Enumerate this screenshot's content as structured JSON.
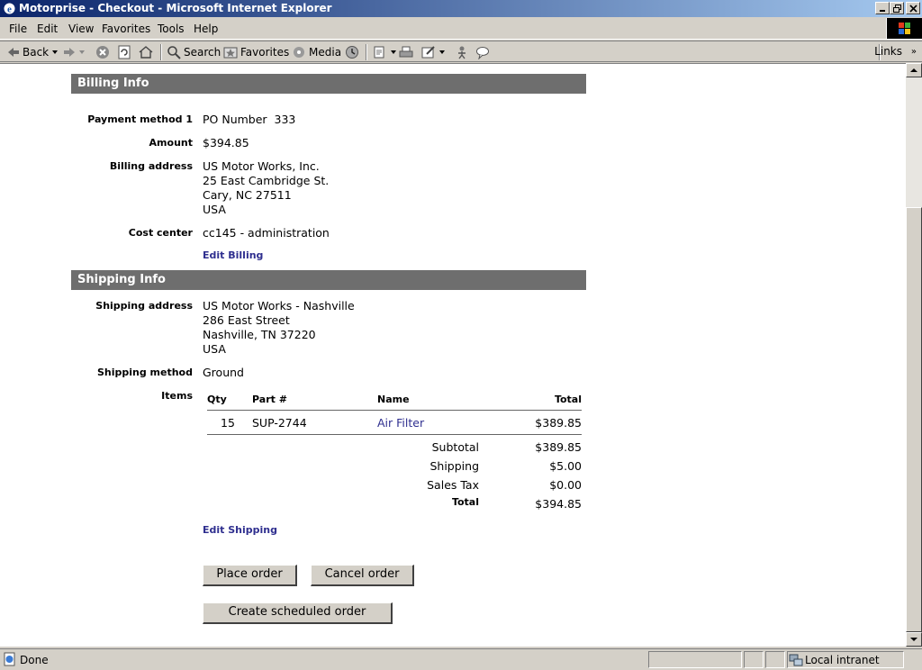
{
  "window": {
    "title": "Motorprise - Checkout - Microsoft Internet Explorer"
  },
  "menu": {
    "items": [
      "File",
      "Edit",
      "View",
      "Favorites",
      "Tools",
      "Help"
    ]
  },
  "toolbar": {
    "back_label": "Back",
    "search_label": "Search",
    "favorites_label": "Favorites",
    "media_label": "Media",
    "links_label": "Links"
  },
  "billing": {
    "header": "Billing Info",
    "payment_method_label": "Payment method 1",
    "payment_method_value": "PO Number  333",
    "amount_label": "Amount",
    "amount_value": "$394.85",
    "address_label": "Billing address",
    "address_lines": [
      "US Motor Works, Inc.",
      "25 East Cambridge St.",
      "Cary, NC 27511",
      "USA"
    ],
    "cost_center_label": "Cost center",
    "cost_center_value": "cc145 - administration",
    "edit_link": "Edit Billing"
  },
  "shipping": {
    "header": "Shipping Info",
    "address_label": "Shipping address",
    "address_lines": [
      "US Motor Works - Nashville",
      "286 East Street",
      "Nashville, TN 37220",
      "USA"
    ],
    "method_label": "Shipping method",
    "method_value": "Ground",
    "items_label": "Items",
    "columns": [
      "Qty",
      "Part #",
      "Name",
      "Total"
    ],
    "rows": [
      {
        "qty": "15",
        "part": "SUP-2744",
        "name": "Air Filter",
        "total": "$389.85"
      }
    ],
    "summary": {
      "subtotal_label": "Subtotal",
      "subtotal_value": "$389.85",
      "shipping_label": "Shipping",
      "shipping_value": "$5.00",
      "tax_label": "Sales Tax",
      "tax_value": "$0.00",
      "total_label": "Total",
      "total_value": "$394.85"
    },
    "edit_link": "Edit Shipping"
  },
  "actions": {
    "place_order": "Place order",
    "cancel_order": "Cancel order",
    "create_scheduled": "Create scheduled order"
  },
  "status": {
    "text": "Done",
    "zone": "Local intranet"
  }
}
